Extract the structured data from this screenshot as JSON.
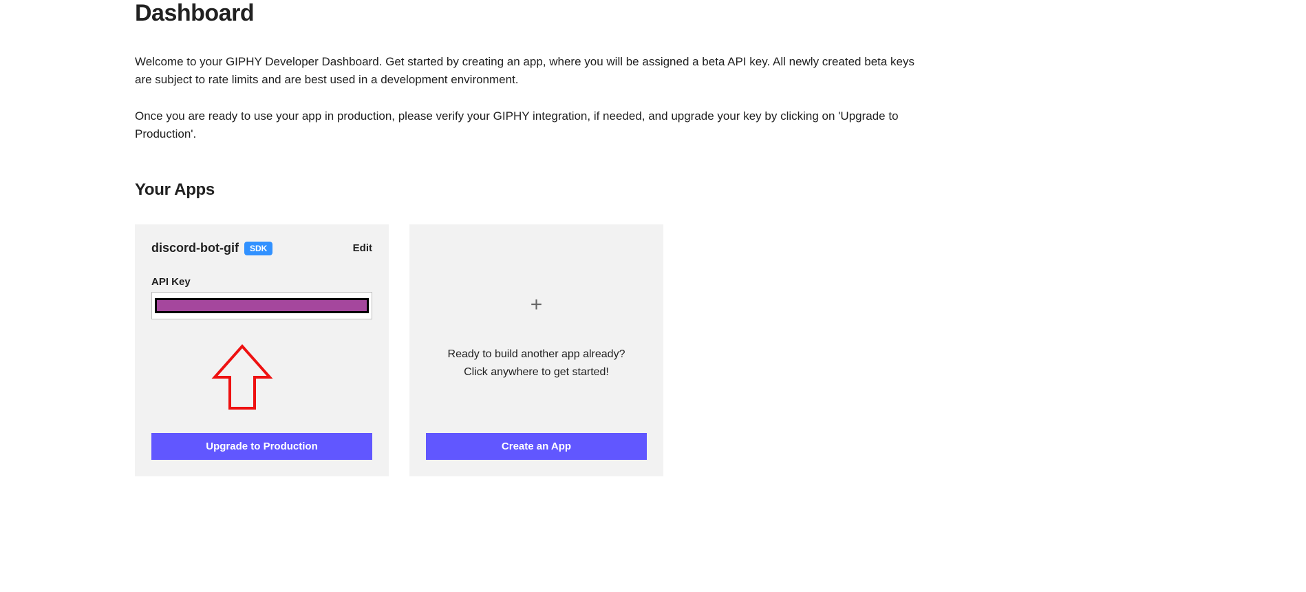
{
  "page": {
    "title": "Dashboard",
    "intro_p1": "Welcome to your GIPHY Developer Dashboard. Get started by creating an app, where you will be assigned a beta API key. All newly created beta keys are subject to rate limits and are best used in a development environment.",
    "intro_p2": "Once you are ready to use your app in production, please verify your GIPHY integration, if needed, and upgrade your key by clicking on 'Upgrade to Production'.",
    "apps_section_title": "Your Apps"
  },
  "app": {
    "name": "discord-bot-gif",
    "badge": "SDK",
    "edit_label": "Edit",
    "api_key_label": "API Key",
    "upgrade_button": "Upgrade to Production"
  },
  "create": {
    "text_line1": "Ready to build another app already?",
    "text_line2": "Click anywhere to get started!",
    "button": "Create an App"
  }
}
